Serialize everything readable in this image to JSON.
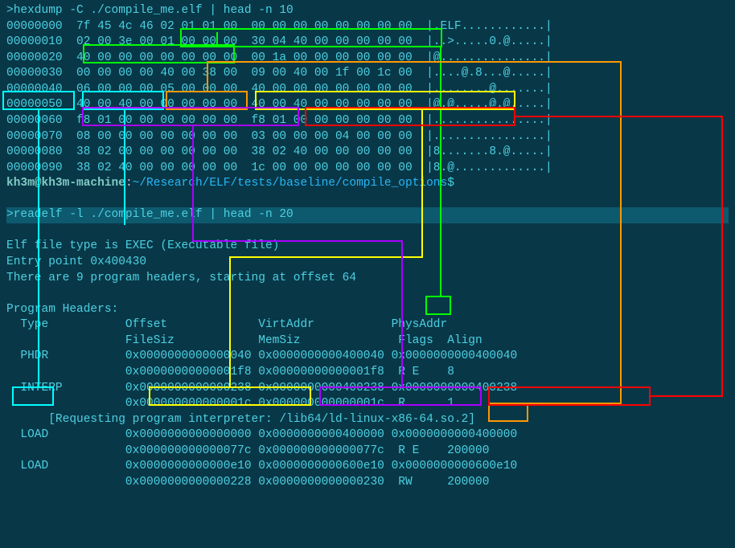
{
  "hexdump": {
    "command": ">hexdump -C ./compile_me.elf | head -n 10",
    "rows": [
      {
        "addr": "00000000",
        "hex": "7f 45 4c 46 02 01 01 00  00 00 00 00 00 00 00 00",
        "ascii": "|.ELF............|"
      },
      {
        "addr": "00000010",
        "hex": "02 00 3e 00 01 00 00 00  30 04 40 00 00 00 00 00",
        "ascii": "|..>.....0.@.....|"
      },
      {
        "addr": "00000020",
        "hex": "40 00 00 00 00 00 00 00  00 1a 00 00 00 00 00 00",
        "ascii": "|@...............|"
      },
      {
        "addr": "00000030",
        "hex": "00 00 00 00 40 00 38 00  09 00 40 00 1f 00 1c 00",
        "ascii": "|....@.8...@.....|"
      },
      {
        "addr": "00000040",
        "hex": "06 00 00 00 05 00 00 00  40 00 00 00 00 00 00 00",
        "ascii": "|........@.......|"
      },
      {
        "addr": "00000050",
        "hex": "40 00 40 00 00 00 00 00  40 00 40 00 00 00 00 00",
        "ascii": "|@.@.....@.@.....|"
      },
      {
        "addr": "00000060",
        "hex": "f8 01 00 00 00 00 00 00  f8 01 00 00 00 00 00 00",
        "ascii": "|................|"
      },
      {
        "addr": "00000070",
        "hex": "08 00 00 00 00 00 00 00  03 00 00 00 04 00 00 00",
        "ascii": "|................|"
      },
      {
        "addr": "00000080",
        "hex": "38 02 00 00 00 00 00 00  38 02 40 00 00 00 00 00",
        "ascii": "|8.......8.@.....|"
      },
      {
        "addr": "00000090",
        "hex": "38 02 40 00 00 00 00 00  1c 00 00 00 00 00 00 00",
        "ascii": "|8.@.............|"
      }
    ]
  },
  "prompt": {
    "user": "kh3m@kh3m-machine",
    "sep": ":",
    "path": "~/Research/ELF/tests/baseline/compile_options",
    "dollar": "$"
  },
  "readelf": {
    "command": ">readelf -l ./compile_me.elf | head -n 20",
    "filetype": "Elf file type is EXEC (Executable file)",
    "entrypoint": "Entry point 0x400430",
    "phdr_count": "There are 9 program headers, starting at offset 64",
    "header_title": "Program Headers:",
    "col_headers_1": "  Type           Offset             VirtAddr           PhysAddr",
    "col_headers_2": "                 FileSiz            MemSiz              Flags  Align",
    "entries": [
      {
        "type": "PHDR",
        "offset": "0x0000000000000040",
        "vaddr": "0x0000000000400040",
        "paddr": "0x0000000000400040",
        "filesz": "0x00000000000001f8",
        "memsz": "0x00000000000001f8",
        "flags": "R E",
        "align": "8"
      },
      {
        "type": "INTERP",
        "offset": "0x0000000000000238",
        "vaddr": "0x0000000000400238",
        "paddr": "0x0000000000400238",
        "filesz": "0x000000000000001c",
        "memsz": "0x000000000000001c",
        "flags": "R",
        "align": "1"
      },
      {
        "note": "[Requesting program interpreter: /lib64/ld-linux-x86-64.so.2]"
      },
      {
        "type": "LOAD",
        "offset": "0x0000000000000000",
        "vaddr": "0x0000000000400000",
        "paddr": "0x0000000000400000",
        "filesz": "0x000000000000077c",
        "memsz": "0x000000000000077c",
        "flags": "R E",
        "align": "200000"
      },
      {
        "type": "LOAD",
        "offset": "0x0000000000000e10",
        "vaddr": "0x0000000000600e10",
        "paddr": "0x0000000000600e10",
        "filesz": "0x0000000000000228",
        "memsz": "0x0000000000000230",
        "flags": "RW",
        "align": "200000"
      }
    ]
  },
  "annotation_colors": {
    "green": "#00ff00",
    "cyan": "#00ffff",
    "orange": "#ff9800",
    "yellow": "#ffff00",
    "purple": "#aa00ff",
    "red": "#ff0000"
  }
}
